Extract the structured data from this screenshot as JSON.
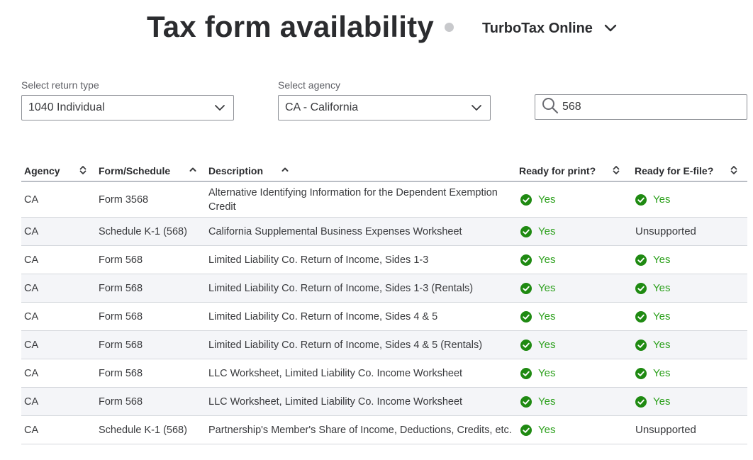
{
  "header": {
    "title": "Tax form availability",
    "product": "TurboTax Online"
  },
  "filters": {
    "return_type": {
      "label": "Select return type",
      "value": "1040 Individual"
    },
    "agency": {
      "label": "Select agency",
      "value": "CA - California"
    },
    "search": {
      "value": "568",
      "icon": "search-icon"
    }
  },
  "table": {
    "columns": [
      {
        "label": "Agency",
        "sort": "both"
      },
      {
        "label": "Form/Schedule",
        "sort": "asc"
      },
      {
        "label": "Description",
        "sort": "asc"
      },
      {
        "label": "Ready for print?",
        "sort": "both"
      },
      {
        "label": "Ready for E-file?",
        "sort": "both"
      }
    ],
    "rows": [
      {
        "agency": "CA",
        "form": "Form 3568",
        "description": "Alternative Identifying Information for the Dependent Exemption Credit",
        "print": "Yes",
        "efile": "Yes"
      },
      {
        "agency": "CA",
        "form": "Schedule K-1 (568)",
        "description": "California Supplemental Business Expenses Worksheet",
        "print": "Yes",
        "efile": "Unsupported"
      },
      {
        "agency": "CA",
        "form": "Form 568",
        "description": "Limited Liability Co. Return of Income, Sides 1-3",
        "print": "Yes",
        "efile": "Yes"
      },
      {
        "agency": "CA",
        "form": "Form 568",
        "description": "Limited Liability Co. Return of Income, Sides 1-3 (Rentals)",
        "print": "Yes",
        "efile": "Yes"
      },
      {
        "agency": "CA",
        "form": "Form 568",
        "description": "Limited Liability Co. Return of Income, Sides 4 & 5",
        "print": "Yes",
        "efile": "Yes"
      },
      {
        "agency": "CA",
        "form": "Form 568",
        "description": "Limited Liability Co. Return of Income, Sides 4 & 5 (Rentals)",
        "print": "Yes",
        "efile": "Yes"
      },
      {
        "agency": "CA",
        "form": "Form 568",
        "description": "LLC Worksheet, Limited Liability Co. Income Worksheet",
        "print": "Yes",
        "efile": "Yes"
      },
      {
        "agency": "CA",
        "form": "Form 568",
        "description": "LLC Worksheet, Limited Liability Co. Income Worksheet",
        "print": "Yes",
        "efile": "Yes"
      },
      {
        "agency": "CA",
        "form": "Schedule K-1 (568)",
        "description": "Partnership's Member's Share of Income, Deductions, Credits, etc.",
        "print": "Yes",
        "efile": "Unsupported"
      }
    ]
  },
  "colors": {
    "accent_green": "#2ca01c",
    "title_text": "#2b2c2f",
    "row_alt": "#f4f5f8"
  }
}
